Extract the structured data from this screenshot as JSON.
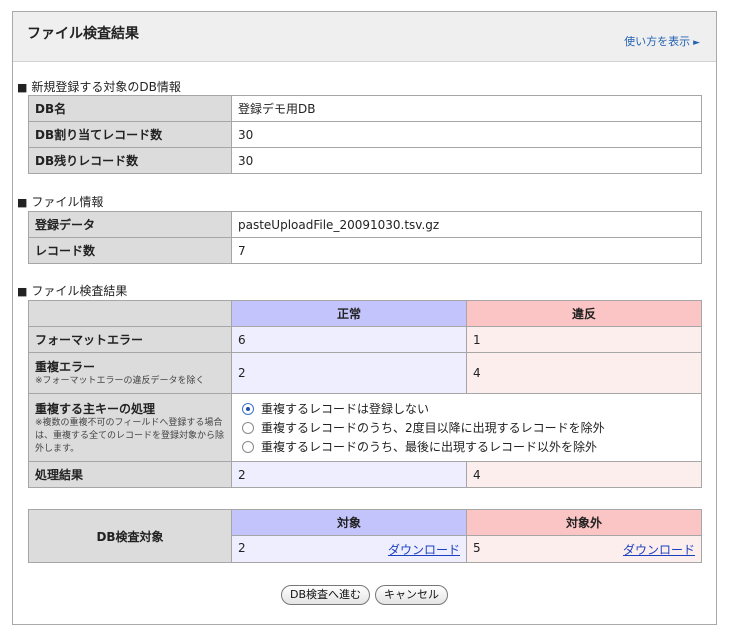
{
  "header": {
    "title": "ファイル検査結果",
    "help_link": "使い方を表示",
    "help_arrow": "►"
  },
  "db_info": {
    "heading": "新規登録する対象のDB情報",
    "rows": [
      {
        "label": "DB名",
        "value": "登録デモ用DB"
      },
      {
        "label": "DB割り当てレコード数",
        "value": "30"
      },
      {
        "label": "DB残りレコード数",
        "value": "30"
      }
    ]
  },
  "file_info": {
    "heading": "ファイル情報",
    "rows": [
      {
        "label": "登録データ",
        "value": "pasteUploadFile_20091030.tsv.gz"
      },
      {
        "label": "レコード数",
        "value": "7"
      }
    ]
  },
  "check_result": {
    "heading": "ファイル検査結果",
    "col_ok": "正常",
    "col_ng": "違反",
    "format_error": {
      "label": "フォーマットエラー",
      "ok": "6",
      "ng": "1"
    },
    "dup_error": {
      "label": "重複エラー",
      "note": "※フォーマットエラーの違反データを除く",
      "ok": "2",
      "ng": "4"
    },
    "pk_handling": {
      "label": "重複する主キーの処理",
      "note": "※複数の重複不可のフィールドへ登録する場合は、重複する全てのレコードを登録対象から除外します。",
      "options": [
        "重複するレコードは登録しない",
        "重複するレコードのうち、2度目以降に出現するレコードを除外",
        "重複するレコードのうち、最後に出現するレコード以外を除外"
      ],
      "selected_index": 0
    },
    "result": {
      "label": "処理結果",
      "ok": "2",
      "ng": "4"
    }
  },
  "db_target": {
    "label": "DB検査対象",
    "col_target": "対象",
    "col_excluded": "対象外",
    "target_count": "2",
    "excluded_count": "5",
    "download_label": "ダウンロード"
  },
  "buttons": {
    "proceed": "DB検査へ進む",
    "cancel": "キャンセル"
  },
  "section_marker": "■"
}
